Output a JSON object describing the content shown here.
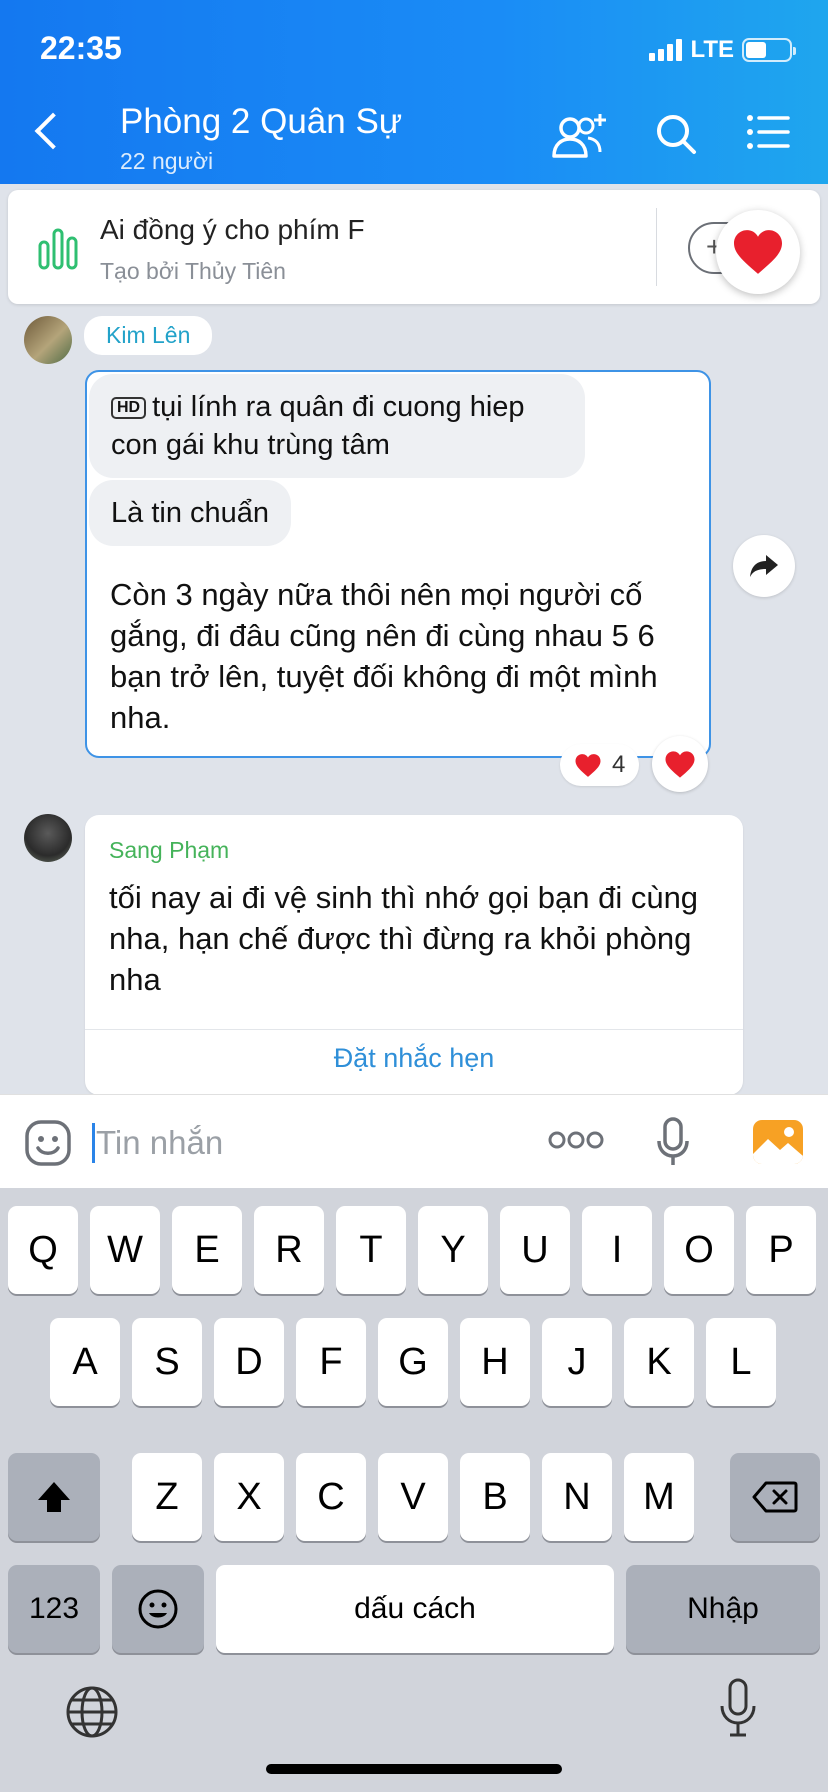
{
  "status_bar": {
    "time": "22:35",
    "network": "LTE"
  },
  "header": {
    "title": "Phòng 2 Quân Sự",
    "subtitle": "22 người"
  },
  "pinned_poll": {
    "question": "Ai đồng ý cho phím F",
    "created_by": "Tạo bởi Thủy Tiên",
    "add_label": "+"
  },
  "messages": [
    {
      "sender": "Kim Lên",
      "hd_badge": "HD",
      "line1": "tụi lính ra quân đi cuong hiep con gái khu trùng tâm",
      "line2": "Là tin chuẩn",
      "line3": "Còn 3 ngày nữa thôi nên mọi người cố gắng, đi đâu cũng nên đi cùng nhau 5 6 bạn trở lên, tuyệt đối không đi một mình nha.",
      "reaction_count": "4"
    },
    {
      "sender": "Sang Phạm",
      "text": "tối nay ai đi vệ sinh thì nhớ gọi bạn đi cùng nha, hạn chế được thì đừng ra khỏi phòng nha",
      "action": "Đặt nhắc hẹn"
    }
  ],
  "input": {
    "placeholder": "Tin nhắn"
  },
  "keyboard": {
    "row1": [
      "Q",
      "W",
      "E",
      "R",
      "T",
      "Y",
      "U",
      "I",
      "O",
      "P"
    ],
    "row2": [
      "A",
      "S",
      "D",
      "F",
      "G",
      "H",
      "J",
      "K",
      "L"
    ],
    "row3": [
      "Z",
      "X",
      "C",
      "V",
      "B",
      "N",
      "M"
    ],
    "numbers_label": "123",
    "space_label": "dấu cách",
    "return_label": "Nhập"
  },
  "colors": {
    "header_blue": "#1a8cf6",
    "heart_red": "#e8202d",
    "link_blue": "#2f8fd8",
    "sender_green": "#45b35a"
  }
}
